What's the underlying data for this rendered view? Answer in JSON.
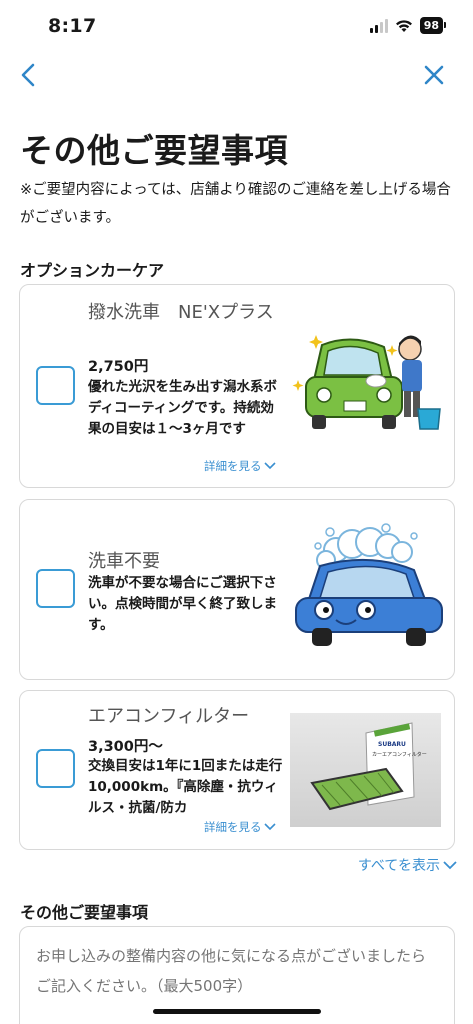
{
  "status": {
    "time": "8:17",
    "battery": "98"
  },
  "page": {
    "title": "その他ご要望事項",
    "note": "※ご要望内容によっては、店舗より確認のご連絡を差し上げる場合がございます。"
  },
  "option_section": {
    "label": "オプションカーケア",
    "items": [
      {
        "title": "撥水洗車　NE'Xプラス",
        "price": "2,750円",
        "description": "優れた光沢を生み出す潟水系ボディコーティングです。持続効果の目安は１～3ヶ月です",
        "more_label": "詳細を見る"
      },
      {
        "title": "洗車不要",
        "price": "",
        "description": "洗車が不要な場合にご選択下さい。点検時間が早く終了致します。",
        "more_label": ""
      },
      {
        "title": "エアコンフィルター",
        "price": "3,300円～",
        "description": "交換目安は1年に1回または走行10,000km。『高除塵・抗ウィルス・抗菌/防カ",
        "more_label": "詳細を見る"
      }
    ],
    "show_all_label": "すべてを表示"
  },
  "request_section": {
    "label": "その他ご要望事項",
    "placeholder": "お申し込みの整備内容の他に気になる点がございましたらご記入ください。（最大500字）"
  },
  "product_box": {
    "brand": "SUBARU",
    "name": "カーエアコンフィルター"
  },
  "colors": {
    "accent": "#3a8fd0",
    "checkbox_border": "#3a9bd5",
    "card_border": "#d8d8d8"
  }
}
